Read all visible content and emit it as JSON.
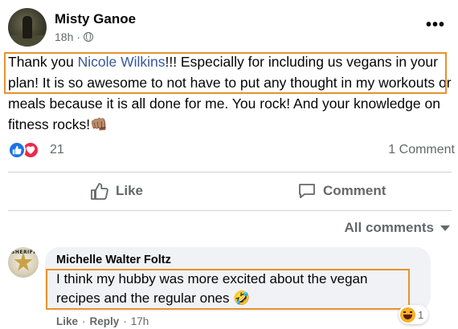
{
  "post": {
    "author": "Misty Ganoe",
    "time": "18h",
    "separator": "·",
    "privacy_icon": "globe-icon",
    "more_icon": "more-options-icon",
    "text_before": "Thank you ",
    "mention": "Nicole Wilkins",
    "text_after": "!!! Especially for including us vegans in your plan! It is so awesome to not have to put any thought in my workouts or meals because it is all done for me. You rock! And your knowledge on fitness rocks!",
    "emoji": "👊🏽"
  },
  "reactions": {
    "icons": [
      "like-reaction-icon",
      "love-reaction-icon"
    ],
    "count": "21",
    "comments": "1 Comment"
  },
  "actions": {
    "like": "Like",
    "comment": "Comment"
  },
  "filter": {
    "label": "All comments"
  },
  "comment": {
    "author": "Michelle Walter Foltz",
    "text": "I think my hubby was more excited about the vegan recipes and the regular ones",
    "emoji": "🤣",
    "reaction_icon": "haha-reaction-icon",
    "reaction_count": "1",
    "like": "Like",
    "reply": "Reply",
    "dot": "·",
    "time": "17h"
  },
  "colors": {
    "highlight": "#e8912d",
    "mention": "#385898",
    "like_blue": "#1b74e4",
    "love_red": "#f0284a",
    "muted": "#65676b"
  }
}
